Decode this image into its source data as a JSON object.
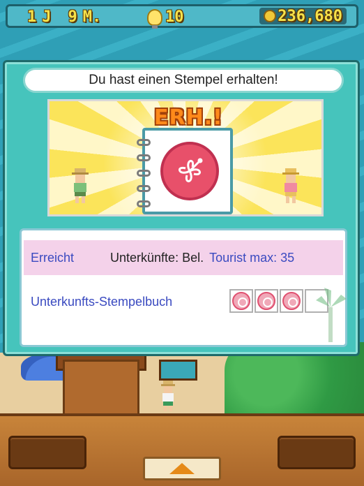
{
  "topbar": {
    "year_value": "1",
    "year_unit": "J",
    "month_value": "9",
    "month_unit": "M.",
    "ideas": "10",
    "money": "236,680"
  },
  "dialog": {
    "title": "Du hast einen Stempel erhalten!",
    "scene_banner": "ERH.!"
  },
  "info": {
    "reached_label": "Erreicht",
    "reached_value": "Unterkünfte: Bel.",
    "reached_extra": "Tourist max: 35",
    "book_label": "Unterkunfts-Stempelbuch",
    "stamps_filled": 3,
    "stamps_total": 4
  },
  "colors": {
    "accent": "#46c4bc",
    "stamp": "#e8506a",
    "link_text": "#3a4ac0",
    "highlight_row": "#f4d2ea"
  },
  "icons": [
    "lightbulb-icon",
    "coin-icon",
    "hibiscus-icon",
    "up-arrow-icon"
  ]
}
